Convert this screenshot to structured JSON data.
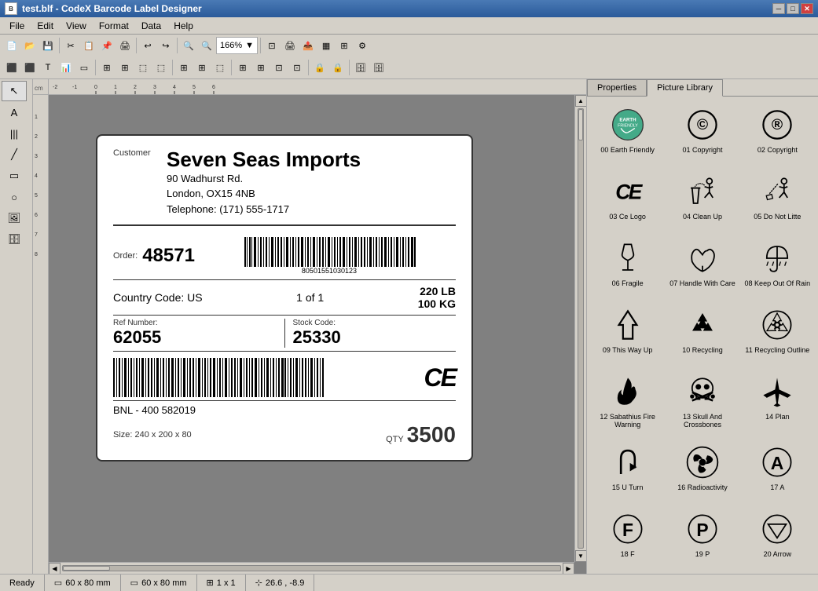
{
  "titleBar": {
    "title": "test.blf - CodeX Barcode Label Designer",
    "minimizeBtn": "─",
    "restoreBtn": "□",
    "closeBtn": "✕"
  },
  "menuBar": {
    "items": [
      "File",
      "Edit",
      "View",
      "Format",
      "Data",
      "Help"
    ]
  },
  "toolbar": {
    "zoom": "166%"
  },
  "label": {
    "customerLabel": "Customer",
    "companyName": "Seven Seas Imports",
    "address1": "90 Wadhurst Rd.",
    "address2": "London, OX15 4NB",
    "address3": "Telephone: (171) 555-1717",
    "orderLabel": "Order:",
    "orderNum": "48571",
    "barcodeNum": "80501551030123",
    "countryLabel": "Country Code: US",
    "ofText": "1 of 1",
    "weight1": "220 LB",
    "weight2": "100 KG",
    "refLabel": "Ref Number:",
    "refNum": "62055",
    "stockLabel": "Stock Code:",
    "stockNum": "25330",
    "bnl": "BNL - 400 582019",
    "sizeLabel": "Size: 240 x 200 x 80",
    "qtyLabel": "QTY",
    "qty": "3500"
  },
  "rightPanel": {
    "tabs": [
      "Properties",
      "Picture Library"
    ],
    "activeTab": "Picture Library"
  },
  "library": {
    "items": [
      {
        "id": 0,
        "label": "00 Earth Friendly",
        "icon": "earth"
      },
      {
        "id": 1,
        "label": "01 Copyright",
        "icon": "copyright-c"
      },
      {
        "id": 2,
        "label": "02 Copyright",
        "icon": "copyright-r"
      },
      {
        "id": 3,
        "label": "03 Ce Logo",
        "icon": "ce"
      },
      {
        "id": 4,
        "label": "04 Clean Up",
        "icon": "clean-up"
      },
      {
        "id": 5,
        "label": "05 Do Not Litte",
        "icon": "do-not-litter"
      },
      {
        "id": 6,
        "label": "06 Fragile",
        "icon": "fragile"
      },
      {
        "id": 7,
        "label": "07 Handle With Care",
        "icon": "handle"
      },
      {
        "id": 8,
        "label": "08 Keep Out Of Rain",
        "icon": "keep-dry"
      },
      {
        "id": 9,
        "label": "09 This Way Up",
        "icon": "this-way-up"
      },
      {
        "id": 10,
        "label": "10 Recycling",
        "icon": "recycle"
      },
      {
        "id": 11,
        "label": "11 Recycling Outline",
        "icon": "recycle-outline"
      },
      {
        "id": 12,
        "label": "12 Sabathius Fire Warning",
        "icon": "fire"
      },
      {
        "id": 13,
        "label": "13 Skull And Crossbones",
        "icon": "skull"
      },
      {
        "id": 14,
        "label": "14 Plan",
        "icon": "plane"
      },
      {
        "id": 15,
        "label": "15 U Turn",
        "icon": "uturn"
      },
      {
        "id": 16,
        "label": "16 Radioactivity",
        "icon": "radioactive"
      },
      {
        "id": 17,
        "label": "17 A",
        "icon": "letter-a"
      },
      {
        "id": 18,
        "label": "18 F",
        "icon": "letter-f"
      },
      {
        "id": 19,
        "label": "19 P",
        "icon": "letter-p"
      },
      {
        "id": 20,
        "label": "20 Arrow",
        "icon": "arrow-down"
      }
    ]
  },
  "statusBar": {
    "ready": "Ready",
    "size1": "60 x 80 mm",
    "size2": "60 x 80 mm",
    "grid": "1 x 1",
    "coords": "26.6 , -8.9"
  }
}
